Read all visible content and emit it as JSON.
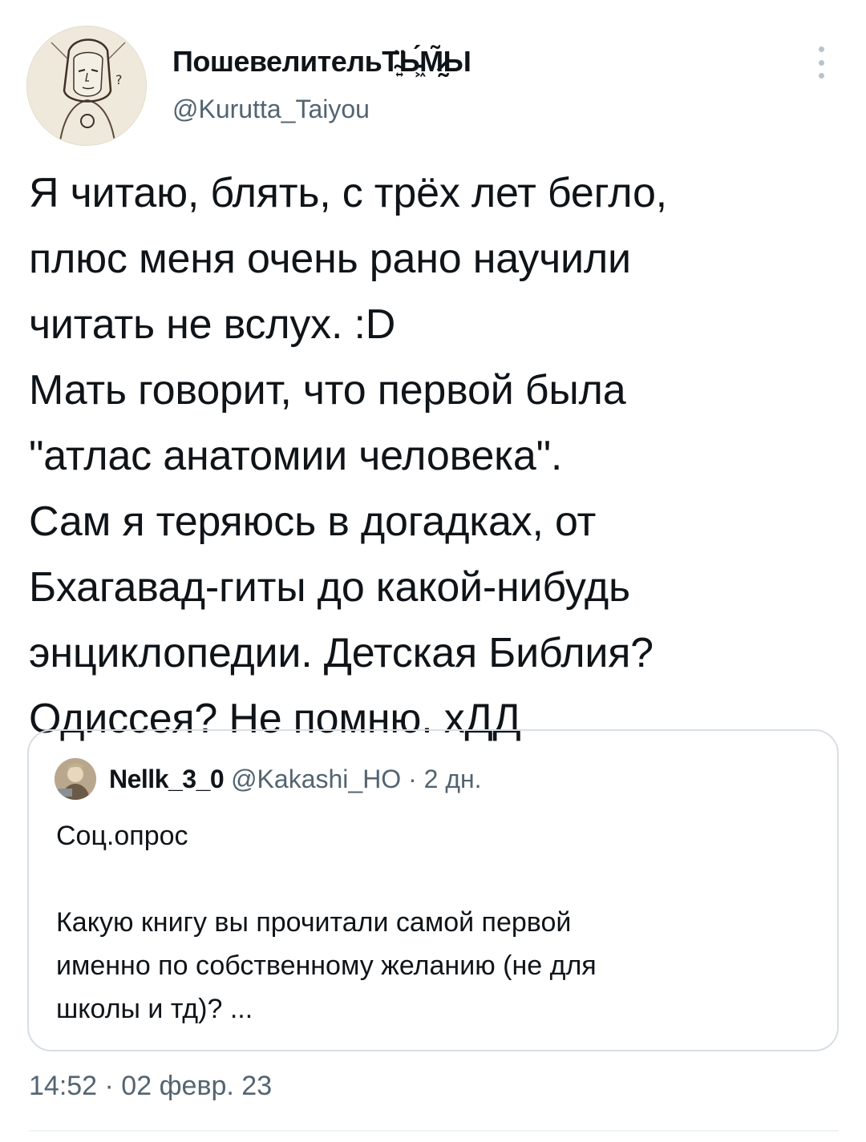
{
  "author": {
    "name": "ПошевелительТ̴͍̈Ь̵͖́М̷̰̃Ы",
    "handle": "@Kurutta_Taiyou"
  },
  "tweet": {
    "text": "Я читаю, блять, с трёх лет бегло,\nплюс меня очень рано научили\nчитать не вслух. :D\nМать говорит, что первой была\n\"атлас анатомии человека\".\nСам я теряюсь в догадках, от\nБхагавад-гиты до какой-нибудь\nэнциклопедии. Детская Библия?\nОдиссея? Не помню. хДД",
    "timestamp": "14:52 · 02 февр. 23"
  },
  "quote": {
    "name": "Nellk_3_0",
    "handle": "@Kakashi_HO",
    "time": " · 2 дн.",
    "body": "Соц.опрос\n\nКакую книгу вы прочитали самой первой\nименно по собственному желанию (не для\nшколы и тд)? ..."
  },
  "icons": {
    "more": "more-vertical-icon",
    "avatar": "avatar-icon"
  },
  "colors": {
    "text": "#0f1419",
    "secondary": "#536471",
    "border": "#d8dee3"
  }
}
